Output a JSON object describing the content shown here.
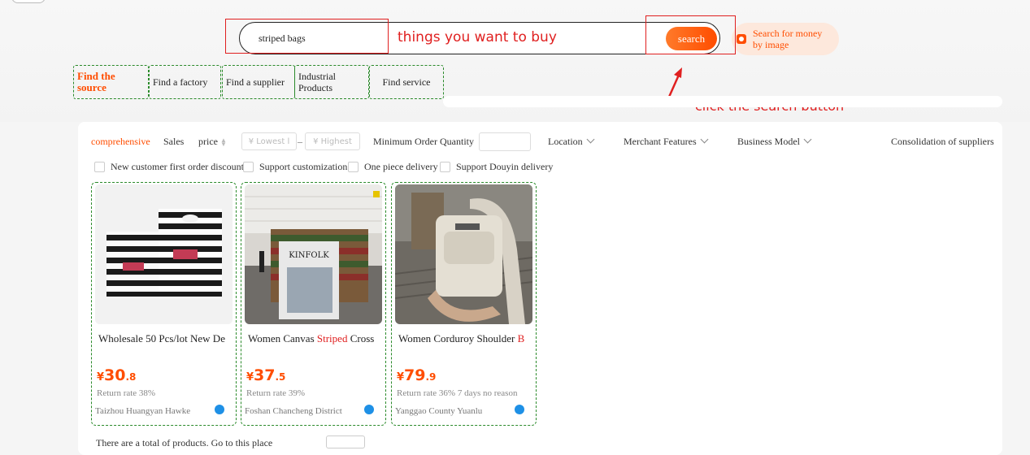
{
  "search": {
    "value": "striped bags",
    "button_label": "search",
    "image_search_label": "Search for money by image"
  },
  "annotations": {
    "hint_text": "things you want to buy",
    "click_hint": "click the search button"
  },
  "category_tabs": [
    {
      "label": "Find the source",
      "active": true
    },
    {
      "label": "Find a factory",
      "active": false
    },
    {
      "label": "Find a supplier",
      "active": false
    },
    {
      "label": "Industrial Products",
      "active": false
    },
    {
      "label": "Find service",
      "active": false
    }
  ],
  "filters": {
    "comprehensive": "comprehensive",
    "sales": "Sales",
    "price": "price",
    "lowest_placeholder": "¥ Lowest l",
    "dash": "–",
    "highest_placeholder": "¥ Highest",
    "min_order": "Minimum Order Quantity",
    "location": "Location",
    "merchant_features": "Merchant Features",
    "business_model": "Business Model",
    "consolidation": "Consolidation of suppliers"
  },
  "checkbox_filters": [
    "New customer first order discount",
    "Support customization",
    "One piece delivery",
    "Support Douyin delivery"
  ],
  "products": [
    {
      "title_pre": "Wholesale 50 Pcs/lot New De",
      "title_hl": "",
      "title_post": "",
      "currency": "¥",
      "price_int": "30",
      "price_dec": ".8",
      "meta": "Return rate 38%",
      "supplier": "Taizhou Huangyan Hawke"
    },
    {
      "title_pre": "Women Canvas ",
      "title_hl": "Striped",
      "title_post": " Cross",
      "currency": "¥",
      "price_int": "37",
      "price_dec": ".5",
      "meta": "Return rate 39%",
      "supplier": "Foshan Chancheng District"
    },
    {
      "title_pre": "Women Corduroy Shoulder ",
      "title_hl": "B",
      "title_post": "",
      "currency": "¥",
      "price_int": "79",
      "price_dec": ".9",
      "meta": "Return rate 36%  7 days no reason",
      "supplier": "Yanggao County Yuanlu"
    }
  ],
  "product2_image_text": "KINFOLK",
  "bottom_text": "There are a total of products. Go to this place",
  "colors": {
    "accent": "#ff4d00",
    "annotation_red": "#e02020",
    "annotation_green": "#2a8a2a",
    "badge_blue": "#1e90e6"
  }
}
